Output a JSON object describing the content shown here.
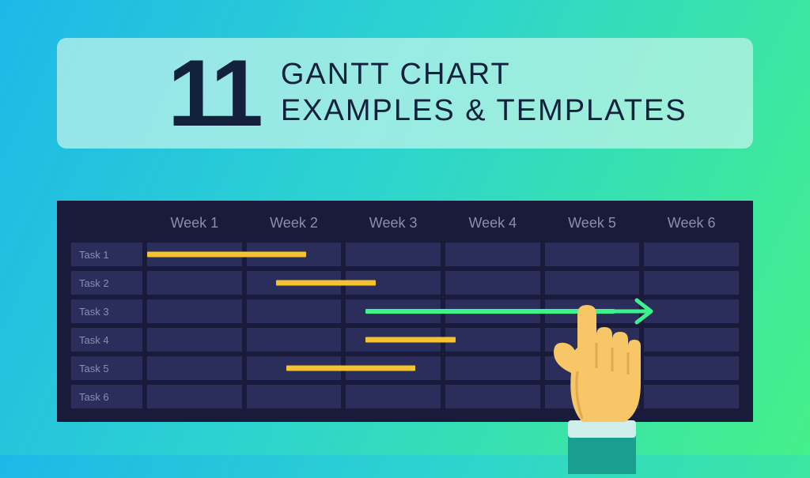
{
  "title": {
    "number": "11",
    "line1": "GANTT CHART",
    "line2": "EXAMPLES & TEMPLATES"
  },
  "chart_data": {
    "type": "gantt",
    "columns": [
      "Week 1",
      "Week 2",
      "Week 3",
      "Week 4",
      "Week 5",
      "Week 6"
    ],
    "tasks": [
      {
        "name": "Task 1",
        "start": 0.0,
        "end": 1.6,
        "color": "#f4c430"
      },
      {
        "name": "Task 2",
        "start": 1.3,
        "end": 2.3,
        "color": "#f4c430"
      },
      {
        "name": "Task 3",
        "start": 2.2,
        "end": 4.7,
        "color": "#3df28c",
        "arrow": true
      },
      {
        "name": "Task 4",
        "start": 2.2,
        "end": 3.1,
        "color": "#f4c430"
      },
      {
        "name": "Task 5",
        "start": 1.4,
        "end": 2.7,
        "color": "#f4c430"
      },
      {
        "name": "Task 6",
        "start": null,
        "end": null,
        "color": null
      }
    ],
    "xlabel": "Week",
    "title": ""
  }
}
